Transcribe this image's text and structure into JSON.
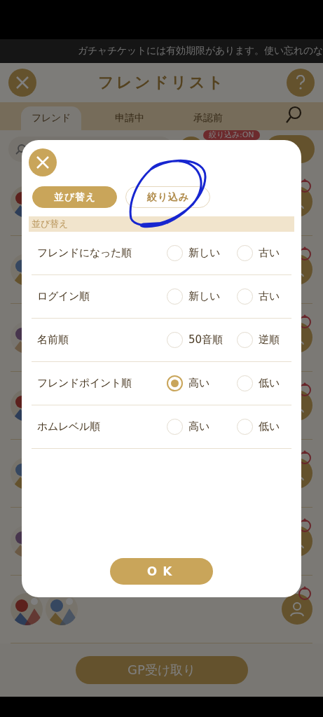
{
  "status_marquee": "ガチャチケットには有効期限があります。使い忘れのな",
  "header": {
    "title": "フレンドリスト"
  },
  "tabs": [
    {
      "label": "フレンド",
      "selected": true
    },
    {
      "label": "申請中",
      "selected": false
    },
    {
      "label": "承認前",
      "selected": false
    }
  ],
  "filter_badge": "絞り込み:ON",
  "bottom_button": "GP受け取り",
  "dialog": {
    "mode_tabs": [
      {
        "label": "並び替え",
        "selected": true
      },
      {
        "label": "絞り込み",
        "selected": false
      }
    ],
    "section_title": "並び替え",
    "sort_rows": [
      {
        "label": "フレンドになった順",
        "options": [
          {
            "label": "新しい",
            "selected": false
          },
          {
            "label": "古い",
            "selected": false
          }
        ]
      },
      {
        "label": "ログイン順",
        "options": [
          {
            "label": "新しい",
            "selected": false
          },
          {
            "label": "古い",
            "selected": false
          }
        ]
      },
      {
        "label": "名前順",
        "options": [
          {
            "label": "50音順",
            "selected": false
          },
          {
            "label": "逆順",
            "selected": false
          }
        ]
      },
      {
        "label": "フレンドポイント順",
        "options": [
          {
            "label": "高い",
            "selected": true
          },
          {
            "label": "低い",
            "selected": false
          }
        ]
      },
      {
        "label": "ホムレベル順",
        "options": [
          {
            "label": "高い",
            "selected": false
          },
          {
            "label": "低い",
            "selected": false
          }
        ]
      }
    ],
    "ok_button": "OK"
  },
  "annotation": {
    "kind": "circle"
  }
}
